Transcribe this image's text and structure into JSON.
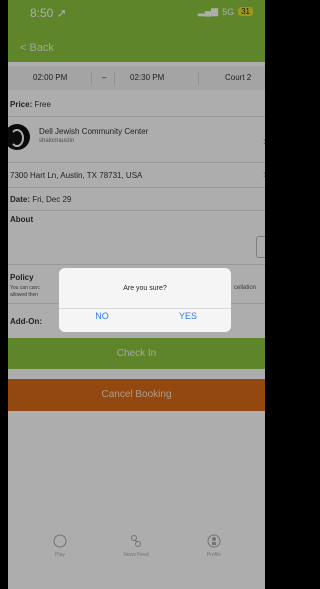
{
  "status": {
    "time": "8:50 ➚",
    "network": "5G",
    "battery": "31"
  },
  "nav": {
    "back_label": "< Back"
  },
  "slot": {
    "start": "02:00 PM",
    "dash": "–",
    "end": "02:30 PM",
    "court": "Court 2"
  },
  "price": {
    "label": "Price:",
    "value": "Free"
  },
  "venue": {
    "name": "Dell Jewish Community Center",
    "handle": "shalomaustin"
  },
  "address": "7300 Hart Ln, Austin, TX 78731, USA",
  "date": {
    "label": "Date:",
    "value": "Fri, Dec 29"
  },
  "about": {
    "label": "About"
  },
  "policy": {
    "label": "Policy",
    "text_line1": "You can canc",
    "text_line2": "allowed then",
    "text_right": "cellation"
  },
  "addon": {
    "label": "Add-On:"
  },
  "buttons": {
    "check_in": "Check In",
    "cancel_booking": "Cancel Booking"
  },
  "tabs": [
    {
      "label": "Play",
      "icon": "circle-icon"
    },
    {
      "label": "News Feed",
      "icon": "news-feed-icon"
    },
    {
      "label": "Profile",
      "icon": "profile-icon"
    }
  ],
  "dialog": {
    "message": "Are you sure?",
    "no": "NO",
    "yes": "YES"
  },
  "colors": {
    "green": "#8bc53f",
    "orange": "#d96a17",
    "dialog_button": "#2b7de9"
  }
}
